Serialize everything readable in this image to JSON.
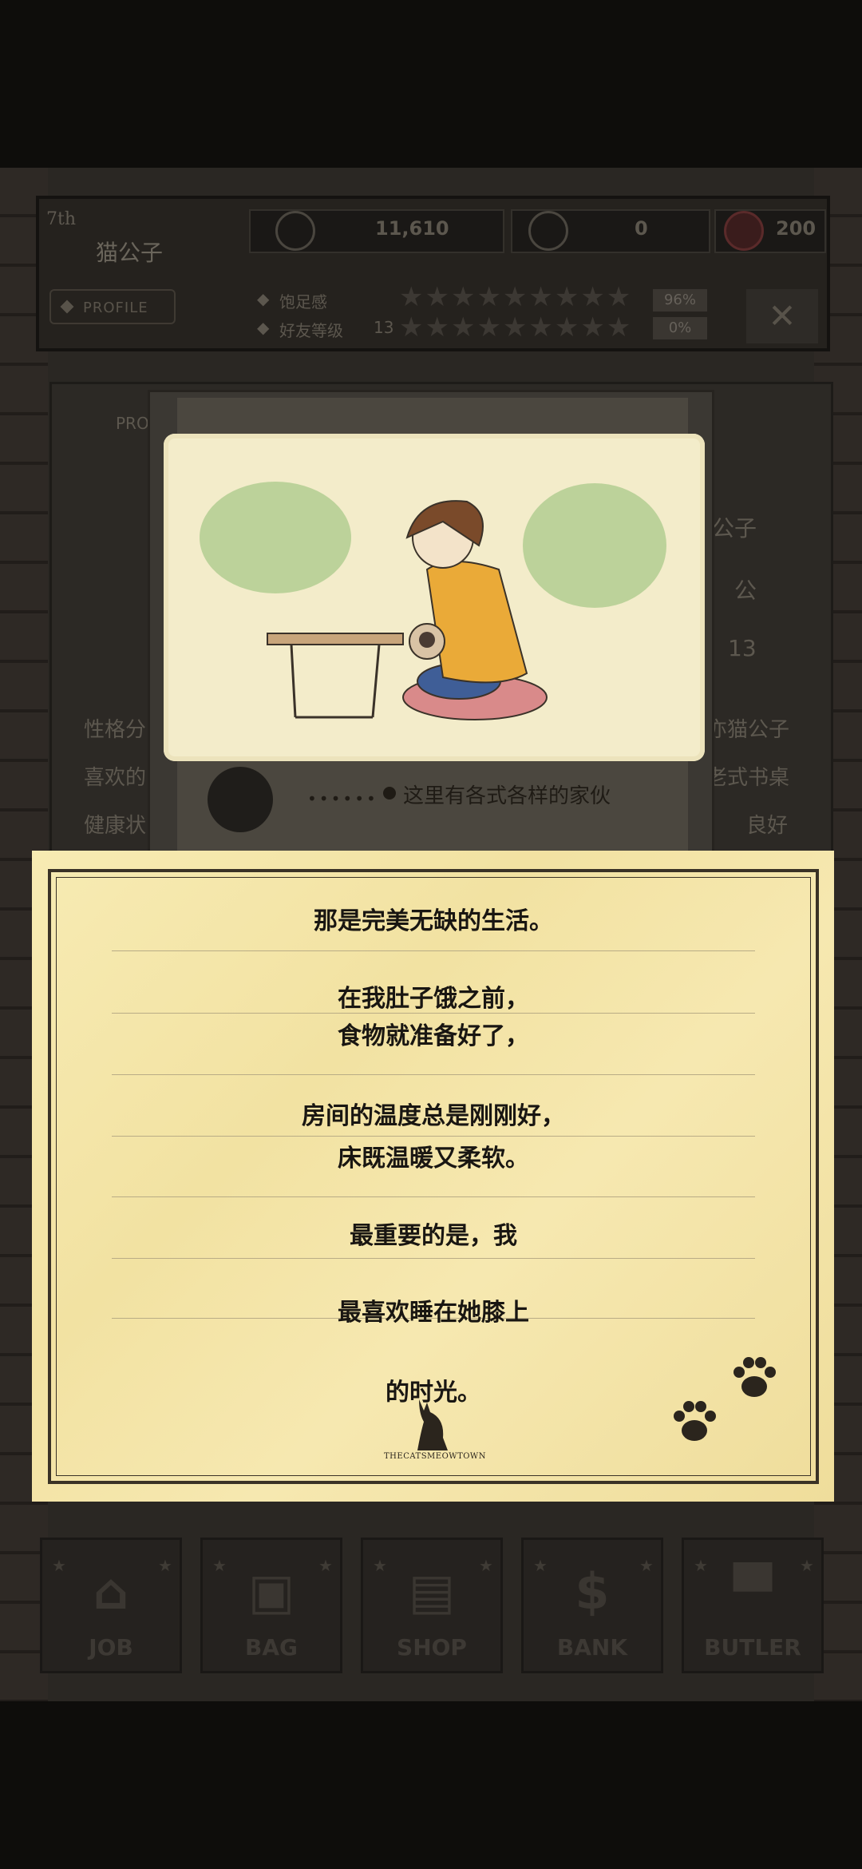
{
  "status": {
    "rank": "7th",
    "cat_name": "猫公子",
    "profile_label": "PROFILE",
    "coins": "11,610",
    "diamonds": "0",
    "hearts": "200",
    "satiety_label": "饱足感",
    "satiety_pct": "96%",
    "friend_label": "好友等级",
    "friend_level": "13",
    "friend_pct": "0%",
    "close_glyph": "✕"
  },
  "profile_card": {
    "tab_label": "PROF",
    "name_value": "公子",
    "gender_value": "公",
    "level_value": "13",
    "personality_label": "性格分",
    "personality_value": "亦猫公子",
    "favorite_label": "喜欢的",
    "favorite_value": "老式书桌",
    "health_label": "健康状",
    "health_value": "良好"
  },
  "memory": {
    "caption": "这里有各式各样的家伙",
    "dots": "••••••"
  },
  "story": {
    "lines": [
      "那是完美无缺的生活。",
      "在我肚子饿之前，",
      "食物就准备好了，",
      "房间的温度总是刚刚好，",
      "床既温暖又柔软。",
      "最重要的是，我",
      "最喜欢睡在她膝上",
      "的时光。"
    ],
    "brand": "THECATSMEOWTOWN"
  },
  "dock": [
    {
      "label": "JOB",
      "icon": "house-icon"
    },
    {
      "label": "BAG",
      "icon": "bag-icon"
    },
    {
      "label": "SHOP",
      "icon": "basket-icon"
    },
    {
      "label": "BANK",
      "icon": "dollar-icon"
    },
    {
      "label": "BUTLER",
      "icon": "tophat-icon"
    }
  ],
  "colors": {
    "paper": "#f5e8ae",
    "ink": "#191612",
    "background": "#0e0d0b"
  }
}
